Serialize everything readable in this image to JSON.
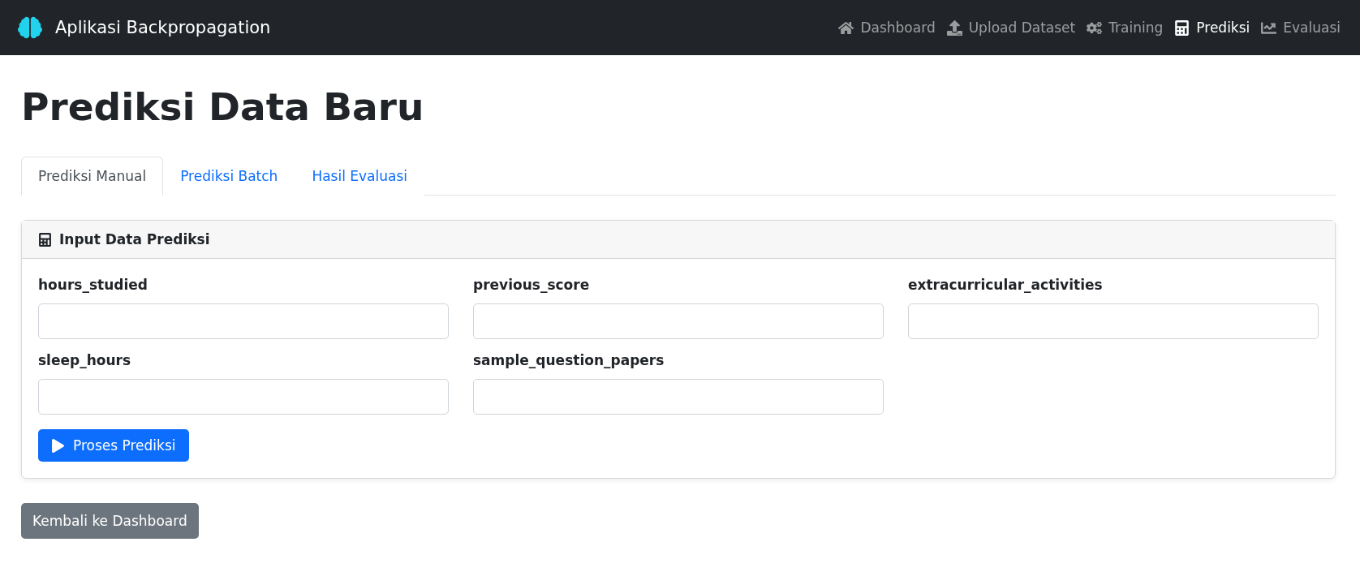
{
  "navbar": {
    "brand": "Aplikasi Backpropagation",
    "items": [
      {
        "label": "Dashboard",
        "selected": false
      },
      {
        "label": "Upload Dataset",
        "selected": false
      },
      {
        "label": "Training",
        "selected": false
      },
      {
        "label": "Prediksi",
        "selected": true
      },
      {
        "label": "Evaluasi",
        "selected": false
      }
    ]
  },
  "page_title": "Prediksi Data Baru",
  "tabs": [
    {
      "label": "Prediksi Manual",
      "selected": true
    },
    {
      "label": "Prediksi Batch",
      "selected": false
    },
    {
      "label": "Hasil Evaluasi",
      "selected": false
    }
  ],
  "card": {
    "title": "Input Data Prediksi",
    "fields": [
      {
        "label": "hours_studied"
      },
      {
        "label": "previous_score"
      },
      {
        "label": "extracurricular_activities"
      },
      {
        "label": "sleep_hours"
      },
      {
        "label": "sample_question_papers"
      }
    ],
    "submit_button": "Proses Prediksi"
  },
  "back_button": "Kembali ke Dashboard"
}
